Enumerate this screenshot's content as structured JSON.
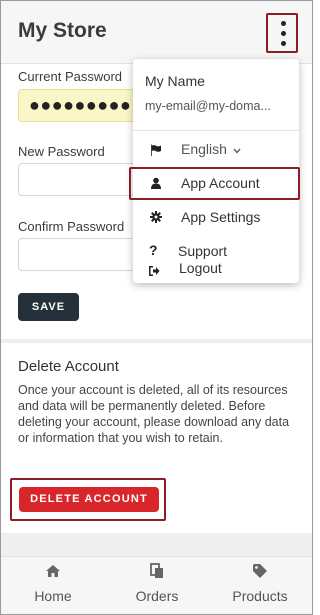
{
  "header": {
    "title": "My Store"
  },
  "form": {
    "current_password_label": "Current Password",
    "current_password_value": "●●●●●●●●●●●",
    "new_password_label": "New Password",
    "new_password_value": "",
    "confirm_password_label": "Confirm Password",
    "confirm_password_value": "",
    "save_label": "SAVE"
  },
  "delete_section": {
    "title": "Delete Account",
    "description": "Once your account is deleted, all of its resources and data will be permanently deleted. Before deleting your account, please download any data or information that you wish to retain.",
    "button_label": "DELETE ACCOUNT"
  },
  "menu": {
    "name": "My Name",
    "email": "my-email@my-doma...",
    "language": "English",
    "items": [
      {
        "label": "App Account",
        "icon": "user-icon"
      },
      {
        "label": "App Settings",
        "icon": "gear-icon"
      },
      {
        "label": "Support",
        "icon": "question-icon"
      },
      {
        "label": "Logout",
        "icon": "logout-icon"
      }
    ]
  },
  "tabs": [
    {
      "label": "Home",
      "icon": "home-icon"
    },
    {
      "label": "Orders",
      "icon": "orders-icon"
    },
    {
      "label": "Products",
      "icon": "tag-icon"
    }
  ],
  "colors": {
    "highlight": "#8c1d22",
    "save_button": "#25303a",
    "delete_button": "#d9262b",
    "password_fill": "#fbf6c8"
  }
}
